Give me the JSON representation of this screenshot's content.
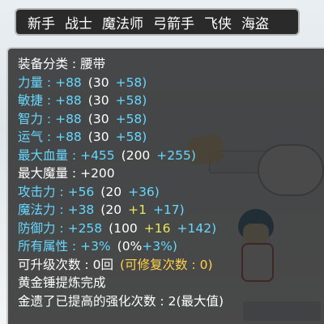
{
  "tabs": [
    "新手",
    "战士",
    "魔法师",
    "弓箭手",
    "飞侠",
    "海盗"
  ],
  "item": {
    "category_label": "装备分类 : ",
    "category_value": "腰带",
    "stats": [
      {
        "name": "力量 : ",
        "total": "+88",
        "base": "(30",
        "bonus_a": "",
        "bonus_b": "+58)"
      },
      {
        "name": "敏捷 : ",
        "total": "+88",
        "base": "(30",
        "bonus_a": "",
        "bonus_b": "+58)"
      },
      {
        "name": "智力 : ",
        "total": "+88",
        "base": "(30",
        "bonus_a": "",
        "bonus_b": "+58)"
      },
      {
        "name": "运气 : ",
        "total": "+88",
        "base": "(30",
        "bonus_a": "",
        "bonus_b": "+58)"
      },
      {
        "name": "最大血量 : ",
        "total": "+455",
        "base": "(200",
        "bonus_a": "",
        "bonus_b": "+255)"
      },
      {
        "name": "最大魔量 : ",
        "total": "+200",
        "base": "",
        "bonus_a": "",
        "bonus_b": ""
      },
      {
        "name": "攻击力 : ",
        "total": "+56",
        "base": "(20",
        "bonus_a": "",
        "bonus_b": "+36)"
      },
      {
        "name": "魔法力 : ",
        "total": "+38",
        "base": "(20",
        "bonus_a": "+1",
        "bonus_b": "+17)"
      },
      {
        "name": "防御力 : ",
        "total": "+258",
        "base": "(100",
        "bonus_a": "+16",
        "bonus_b": "+142)"
      },
      {
        "name": "所有属性 : ",
        "total": "+3%",
        "base": "(0%",
        "bonus_a": "",
        "bonus_b": "+3%)"
      }
    ],
    "upgrade_label": "可升级次数 : ",
    "upgrade_value": "0回",
    "repair_note": "(可修复次数 : 0)",
    "hammer_note": "黄金锤提炼完成",
    "enhance_note": "金遗了已提高的强化次数 : 2(最大值)"
  },
  "colors": {
    "cyan": "#66d7ff",
    "green": "#6cf08a",
    "yellow": "#e8e85a",
    "orange": "#ffd24a"
  }
}
